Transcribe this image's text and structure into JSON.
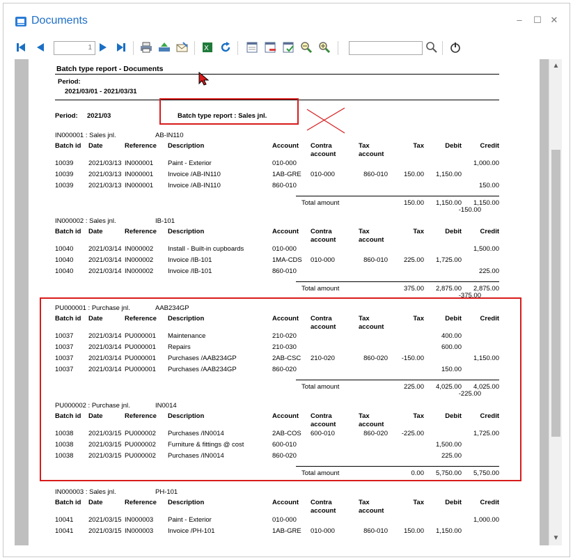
{
  "window": {
    "title": "Documents",
    "minimize": "–",
    "maximize": "☐",
    "close": "✕"
  },
  "toolbar": {
    "page_value": "1"
  },
  "report": {
    "title": "Batch type report - Documents",
    "period_label": "Period:",
    "period_range": "2021/03/01  -   2021/03/31",
    "period_line_label": "Period:",
    "period_line_value": "2021/03",
    "subtitle": "Batch type report : Sales jnl.",
    "headers": [
      "Batch id",
      "Date",
      "Reference",
      "Description",
      "Account",
      "Contra account",
      "Tax account",
      "Tax",
      "Debit",
      "Credit"
    ],
    "header_contra_1": "Contra",
    "header_contra_2": "account",
    "header_taxacc_1": "Tax",
    "header_taxacc_2": "account",
    "total_label": "Total amount",
    "batches": [
      {
        "id_label": "IN000001 : Sales jnl.",
        "ref": "AB-IN110",
        "rows": [
          [
            "10039",
            "2021/03/13",
            "IN000001",
            "Paint - Exterior",
            "010-000",
            "",
            "",
            "",
            "",
            "1,000.00"
          ],
          [
            "10039",
            "2021/03/13",
            "IN000001",
            "Invoice /AB-IN110",
            "1AB-GRE",
            "010-000",
            "860-010",
            "150.00",
            "1,150.00",
            ""
          ],
          [
            "10039",
            "2021/03/13",
            "IN000001",
            "Invoice /AB-IN110",
            "860-010",
            "",
            "",
            "",
            "",
            "150.00"
          ]
        ],
        "total": [
          "150.00",
          "1,150.00",
          "1,150.00"
        ],
        "diff": "-150.00"
      },
      {
        "id_label": "IN000002 : Sales jnl.",
        "ref": "IB-101",
        "rows": [
          [
            "10040",
            "2021/03/14",
            "IN000002",
            "Install - Built-in cupboards",
            "010-000",
            "",
            "",
            "",
            "",
            "1,500.00"
          ],
          [
            "10040",
            "2021/03/14",
            "IN000002",
            "Invoice /IB-101",
            "1MA-CDS",
            "010-000",
            "860-010",
            "225.00",
            "1,725.00",
            ""
          ],
          [
            "10040",
            "2021/03/14",
            "IN000002",
            "Invoice /IB-101",
            "860-010",
            "",
            "",
            "",
            "",
            "225.00"
          ]
        ],
        "total": [
          "375.00",
          "2,875.00",
          "2,875.00"
        ],
        "diff": "-375.00"
      },
      {
        "id_label": "PU000001 : Purchase jnl.",
        "ref": "AAB234GP",
        "rows": [
          [
            "10037",
            "2021/03/14",
            "PU000001",
            "Maintenance",
            "210-020",
            "",
            "",
            "",
            "400.00",
            ""
          ],
          [
            "10037",
            "2021/03/14",
            "PU000001",
            "Repairs",
            "210-030",
            "",
            "",
            "",
            "600.00",
            ""
          ],
          [
            "10037",
            "2021/03/14",
            "PU000001",
            "Purchases /AAB234GP",
            "2AB-CSC",
            "210-020",
            "860-020",
            "-150.00",
            "",
            "1,150.00"
          ],
          [
            "10037",
            "2021/03/14",
            "PU000001",
            "Purchases /AAB234GP",
            "860-020",
            "",
            "",
            "",
            "150.00",
            ""
          ]
        ],
        "total": [
          "225.00",
          "4,025.00",
          "4,025.00"
        ],
        "diff": "-225.00"
      },
      {
        "id_label": "PU000002 : Purchase jnl.",
        "ref": "IN0014",
        "rows": [
          [
            "10038",
            "2021/03/15",
            "PU000002",
            "Purchases /IN0014",
            "2AB-COS",
            "600-010",
            "860-020",
            "-225.00",
            "",
            "1,725.00"
          ],
          [
            "10038",
            "2021/03/15",
            "PU000002",
            "Furniture & fittings @ cost",
            "600-010",
            "",
            "",
            "",
            "1,500.00",
            ""
          ],
          [
            "10038",
            "2021/03/15",
            "PU000002",
            "Purchases /IN0014",
            "860-020",
            "",
            "",
            "",
            "225.00",
            ""
          ]
        ],
        "total": [
          "0.00",
          "5,750.00",
          "5,750.00"
        ],
        "diff": ""
      },
      {
        "id_label": "IN000003 : Sales jnl.",
        "ref": "PH-101",
        "rows": [
          [
            "10041",
            "2021/03/15",
            "IN000003",
            "Paint - Exterior",
            "010-000",
            "",
            "",
            "",
            "",
            "1,000.00"
          ],
          [
            "10041",
            "2021/03/15",
            "IN000003",
            "Invoice /PH-101",
            "1AB-GRE",
            "010-000",
            "860-010",
            "150.00",
            "1,150.00",
            ""
          ]
        ],
        "total": null,
        "diff": ""
      }
    ]
  },
  "colors": {
    "accent": "#1e6fc8",
    "annotation": "#d81b1b",
    "viewer_bg": "#bfbfbf"
  },
  "icons": [
    "first-page-icon",
    "prev-page-icon",
    "next-page-icon",
    "last-page-icon",
    "print-icon",
    "export-icon",
    "email-icon",
    "excel-icon",
    "refresh-icon",
    "layout-icon",
    "remove-icon",
    "check-icon",
    "zoom-out-icon",
    "zoom-in-icon",
    "search-icon",
    "power-icon"
  ]
}
